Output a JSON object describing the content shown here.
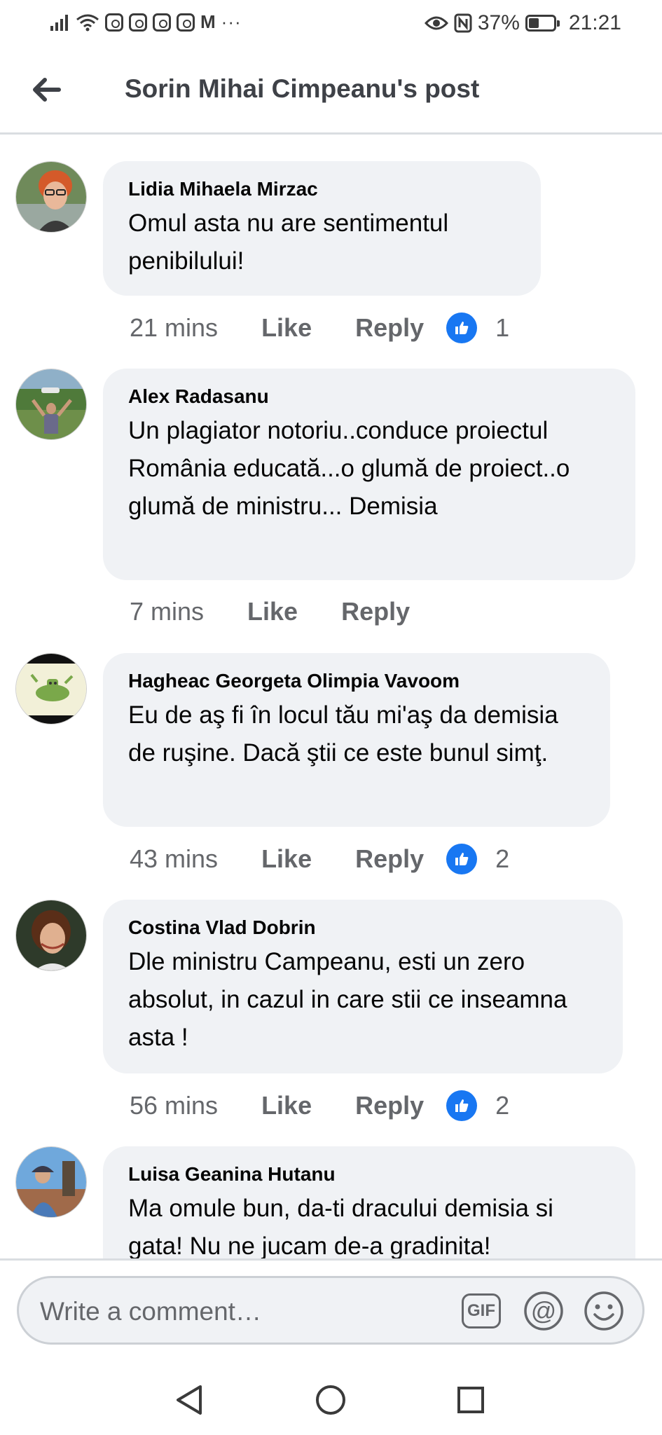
{
  "status_bar": {
    "battery": "37%",
    "time": "21:21",
    "notification_letter": "M",
    "more": "···",
    "icons": [
      "signal-icon",
      "wifi-icon",
      "instagram-icon",
      "gmail-icon",
      "eye-icon",
      "nfc-icon",
      "battery-icon"
    ]
  },
  "header": {
    "title": "Sorin Mihai Cimpeanu's post",
    "back_icon": "arrow-left-icon"
  },
  "comments": [
    {
      "author": "Lidia Mihaela Mirzac",
      "text": "Omul asta nu are sentimentul penibilului!",
      "time": "21 mins",
      "like": "Like",
      "reply": "Reply",
      "reactions": "1"
    },
    {
      "author": "Alex Radasanu",
      "text": "Un plagiator notoriu..conduce proiectul România educată...o glumă de proiect..o glumă de ministru... Demisia",
      "time": "7 mins",
      "like": "Like",
      "reply": "Reply",
      "reactions": ""
    },
    {
      "author": "Hagheac Georgeta Olimpia Vavoom",
      "text": "Eu de aş fi în locul tău mi'aş da demisia de ruşine. Dacă ştii ce este bunul simţ.",
      "time": "43 mins",
      "like": "Like",
      "reply": "Reply",
      "reactions": "2"
    },
    {
      "author": "Costina Vlad Dobrin",
      "text": "Dle ministru Campeanu, esti un zero absolut, in cazul in care stii ce inseamna asta !",
      "time": "56 mins",
      "like": "Like",
      "reply": "Reply",
      "reactions": "2"
    },
    {
      "author": "Luisa Geanina Hutanu",
      "text": "Ma omule bun, da-ti dracului demisia si gata! Nu ne jucam de-a gradinita!",
      "time": "",
      "like": "",
      "reply": "",
      "reactions": ""
    }
  ],
  "compose": {
    "placeholder": "Write a comment…",
    "gif_label": "GIF",
    "mention_icon": "at-sign-icon",
    "emoji_icon": "smiley-icon"
  },
  "nav": {
    "back_icon": "triangle-back-icon",
    "home_icon": "circle-home-icon",
    "recents_icon": "square-recents-icon"
  },
  "colors": {
    "bubble": "#f0f2f5",
    "meta_text": "#65676b",
    "like_blue": "#1877f2"
  }
}
